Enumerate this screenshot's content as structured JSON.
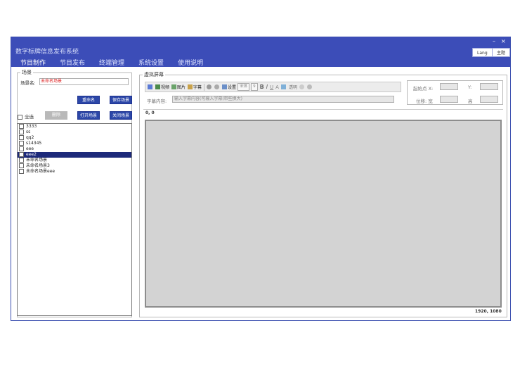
{
  "window": {
    "title": "数字标牌信息发布系统",
    "min_label": "–",
    "close_label": "×"
  },
  "menu": {
    "items": [
      "节目制作",
      "节目发布",
      "终端管理",
      "系统设置",
      "使用说明"
    ]
  },
  "topbar": {
    "lang_label": "Lang",
    "theme_label": "主题"
  },
  "scene_panel": {
    "legend": "场景",
    "name_label": "场景名:",
    "name_value": "未命名场景",
    "rename_button": "重命名",
    "save_button": "保存场景",
    "select_all_label": "全选",
    "delete_button": "删除",
    "open_button": "打开场景",
    "close_button": "关闭场景",
    "scenes": [
      "3333",
      "ss",
      "qq2",
      "s14345",
      "eee",
      "eee2",
      "未命名场景",
      "未命名场景3",
      "未命名场景eee"
    ],
    "selected_index": 5
  },
  "virtual_screen": {
    "legend": "虚拟屏幕",
    "toolbar": {
      "video_label": "视频",
      "image_label": "图片",
      "caption_label": "字幕",
      "settings_label": "设置",
      "font_value": "宋体",
      "size_value": "9",
      "bold": "B",
      "italic": "I",
      "underline": "U",
      "font_color": "A",
      "opacity_label": "透明"
    },
    "caption_label": "字幕内容:",
    "caption_placeholder": "输入字幕内容(可输入字幕(带些换大)",
    "start_label": "起始点 X:",
    "y_label": "Y:",
    "offset_label": "位移: 宽",
    "height_label": "高",
    "origin_coord": "0, 0",
    "end_coord": "1920, 1080"
  },
  "colors": {
    "title_bar": "#3c4db8",
    "selected_row": "#1d2a7a",
    "button_blue": "#2c47a8",
    "canvas": "#d3d3d3"
  }
}
